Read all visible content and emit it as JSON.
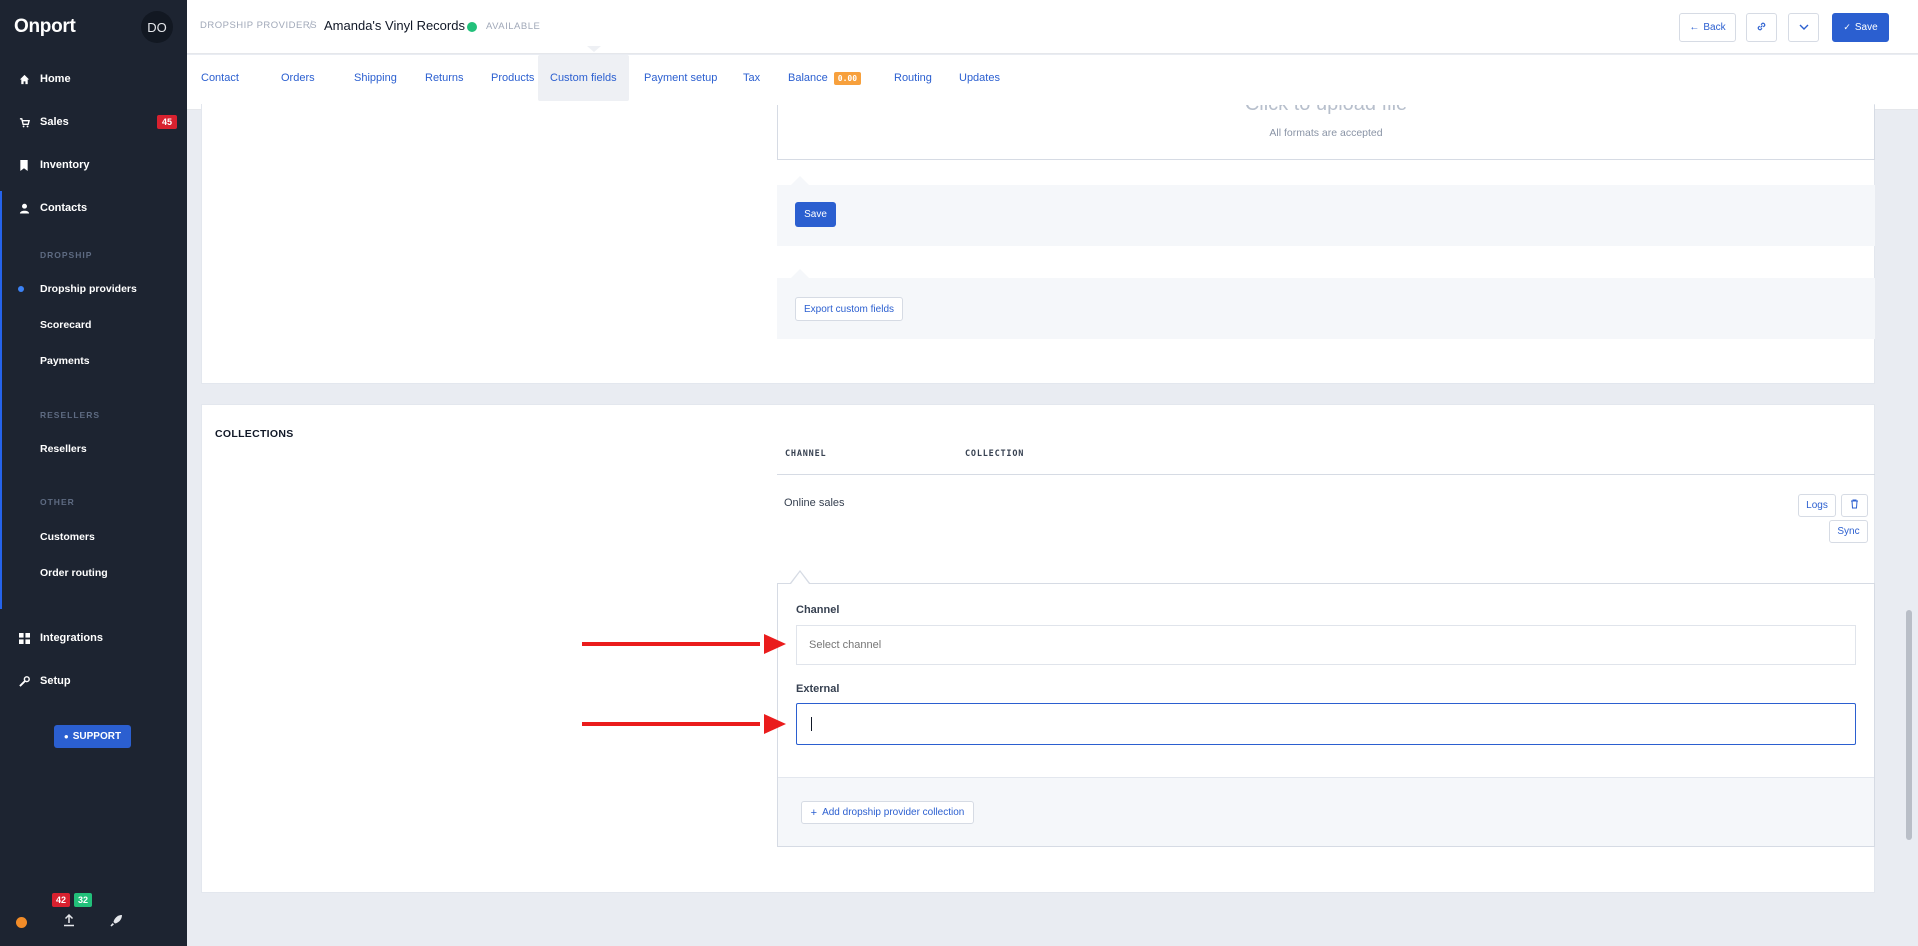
{
  "app": {
    "logo": "Onport",
    "avatar_initials": "DO"
  },
  "sidebar": {
    "items": [
      {
        "label": "Home",
        "icon": "home-icon",
        "glyph": "⌂"
      },
      {
        "label": "Sales",
        "icon": "cart-icon",
        "glyph": "🛒",
        "badge": "45"
      },
      {
        "label": "Inventory",
        "icon": "bookmark-icon",
        "glyph": "■"
      },
      {
        "label": "Contacts",
        "icon": "user-icon",
        "glyph": "●"
      },
      {
        "label": "Integrations",
        "icon": "grid-icon",
        "glyph": "▦"
      },
      {
        "label": "Setup",
        "icon": "wrench-icon",
        "glyph": "✎"
      }
    ],
    "groups": {
      "dropship": {
        "heading": "DROPSHIP",
        "items": [
          "Dropship providers",
          "Scorecard",
          "Payments"
        ]
      },
      "resellers": {
        "heading": "RESELLERS",
        "items": [
          "Resellers"
        ]
      },
      "other": {
        "heading": "OTHER",
        "items": [
          "Customers",
          "Order routing"
        ]
      }
    },
    "support_label": "SUPPORT",
    "bottom": {
      "badge_red": "42",
      "badge_green": "32",
      "status_color": "#f28c28"
    }
  },
  "header": {
    "breadcrumb": "DROPSHIP PROVIDERS",
    "separator": "/",
    "title": "Amanda's Vinyl Records",
    "status": "AVAILABLE",
    "back_label": "Back",
    "save_label": "Save"
  },
  "tabs": {
    "items": [
      "Contact",
      "Orders",
      "Shipping",
      "Returns",
      "Products",
      "Custom fields",
      "Payment setup",
      "Tax",
      "Balance",
      "Routing",
      "Updates"
    ],
    "active": "Custom fields",
    "balance_badge": "0.00"
  },
  "custom_fields": {
    "upload_title": "Click to upload file",
    "upload_subtitle": "All formats are accepted",
    "save_label": "Save",
    "export_label": "Export custom fields"
  },
  "collections": {
    "title": "COLLECTIONS",
    "columns": [
      "CHANNEL",
      "COLLECTION"
    ],
    "rows": [
      {
        "channel": "Online sales",
        "collection": ""
      }
    ],
    "row_actions": {
      "logs": "Logs",
      "sync": "Sync"
    },
    "form": {
      "channel_label": "Channel",
      "channel_placeholder": "Select channel",
      "external_label": "External",
      "external_value": "",
      "add_label": "Add dropship provider collection"
    }
  },
  "colors": {
    "accent": "#2b5fd0",
    "sidebar_bg": "#1d2431",
    "alert": "#ea1c1c",
    "available": "#22c07a",
    "badge_orange": "#f7a03c"
  }
}
